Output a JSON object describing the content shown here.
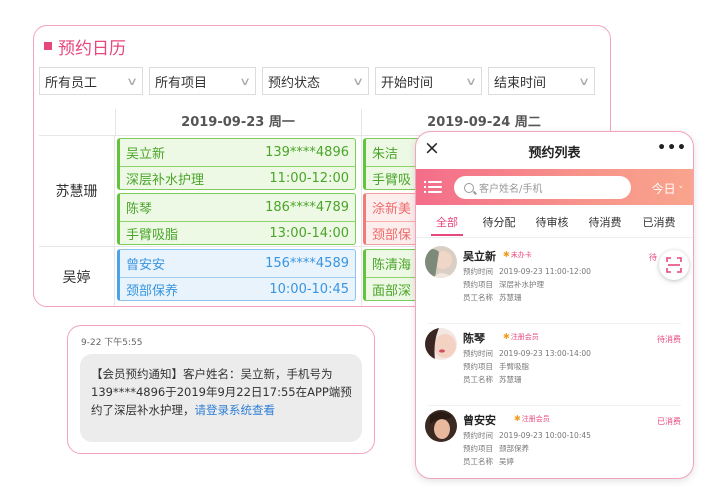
{
  "calendar": {
    "title": "预约日历",
    "filters": [
      "所有员工",
      "所有项目",
      "预约状态",
      "开始时间",
      "结束时间"
    ],
    "dates": [
      "2019-09-23 周一",
      "2019-09-24 周二"
    ],
    "staff": [
      "苏慧珊",
      "吴婷"
    ],
    "cards": [
      {
        "name": "吴立新",
        "phone": "139****4896",
        "service": "深层补水护理",
        "time": "11:00-12:00"
      },
      {
        "name": "陈琴",
        "phone": "186****4789",
        "service": "手臂吸脂",
        "time": "13:00-14:00"
      },
      {
        "name": "曾安安",
        "phone": "156****4589",
        "service": "颈部保养",
        "time": "10:00-10:45"
      },
      {
        "name": "朱洁",
        "service": "手臂吸"
      },
      {
        "name": "涂新美",
        "service": "颈部保"
      },
      {
        "name": "陈清海",
        "service": "面部深"
      }
    ]
  },
  "sms": {
    "time": "9-22 下午5:55",
    "body": "【会员预约通知】客户姓名：吴立新，手机号为139****4896于2019年9月22日17:55在APP端预约了深层补水护理，",
    "link": "请登录系统查看"
  },
  "phone": {
    "title": "预约列表",
    "close_icon": "×",
    "more_icon": "•••",
    "search_placeholder": "客户姓名/手机",
    "today": "今日",
    "tabs": [
      "全部",
      "待分配",
      "待审核",
      "待消费",
      "已消费"
    ],
    "appointments": [
      {
        "name": "吴立新",
        "tag": "未办卡",
        "time_label": "预约时间",
        "time": "2019-09-23 11:00-12:00",
        "project_label": "预约项目",
        "project": "深层补水护理",
        "staff_label": "员工名称",
        "staff": "苏慧珊",
        "status": "待"
      },
      {
        "name": "陈琴",
        "tag": "注册会员",
        "time_label": "预约时间",
        "time": "2019-09-23 13:00-14:00",
        "project_label": "预约项目",
        "project": "手臂吸脂",
        "staff_label": "员工名称",
        "staff": "苏慧珊",
        "status": "待消费"
      },
      {
        "name": "曾安安",
        "tag": "注册会员",
        "time_label": "预约时间",
        "time": "2019-09-23 10:00-10:45",
        "project_label": "预约项目",
        "project": "颈部保养",
        "staff_label": "员工名称",
        "staff": "吴婷",
        "status": "已消费"
      }
    ]
  },
  "colors": {
    "accent": "#e8477e",
    "green": "#62c33c",
    "blue": "#4aa3e8",
    "red": "#f07b7b"
  }
}
